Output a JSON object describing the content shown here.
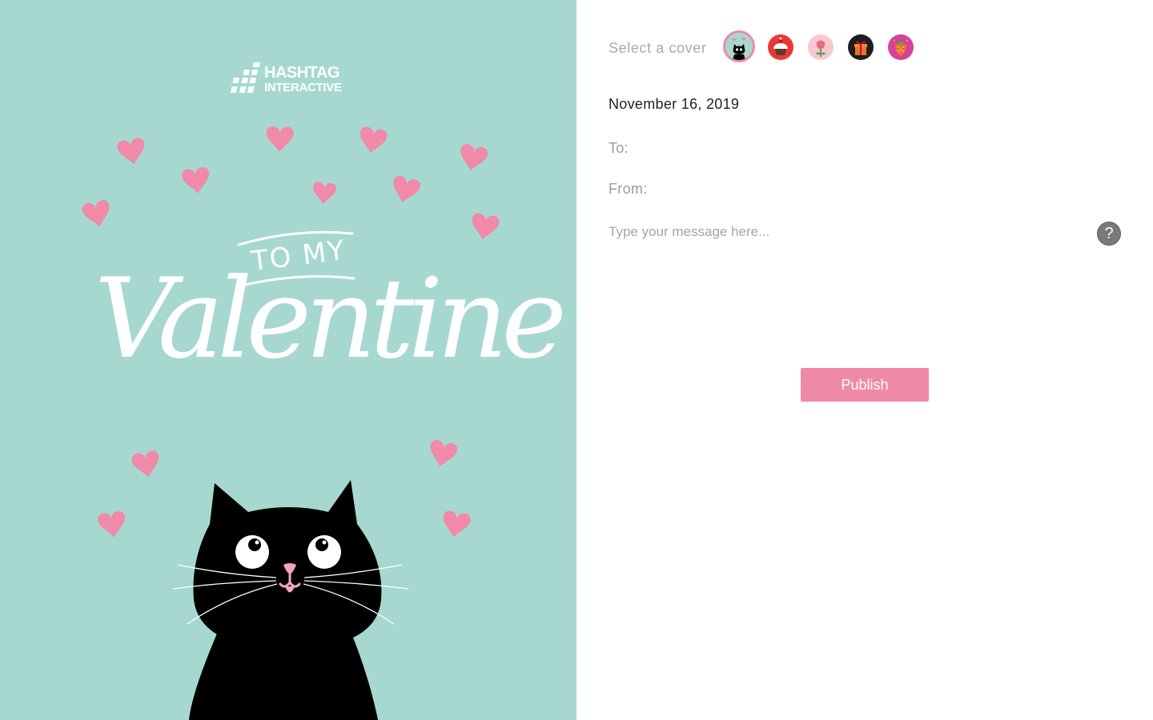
{
  "card": {
    "brand_line1": "HASHTAG",
    "brand_line2": "INTERACTIVE",
    "greeting_small": "TO MY",
    "greeting_big": "Valentine",
    "background_color": "#a6d8d0",
    "heart_color": "#f08aa8"
  },
  "form": {
    "select_cover_label": "Select a cover",
    "covers": [
      {
        "name": "black cat on mint",
        "icon": "cat-icon",
        "selected": true
      },
      {
        "name": "cupcake on red",
        "icon": "cupcake-icon",
        "selected": false
      },
      {
        "name": "rose on pink",
        "icon": "rose-icon",
        "selected": false
      },
      {
        "name": "gift on black",
        "icon": "gift-icon",
        "selected": false
      },
      {
        "name": "strawberry on magenta",
        "icon": "strawberry-icon",
        "selected": false
      }
    ],
    "date": "November 16, 2019",
    "to_label": "To:",
    "from_label": "From:",
    "message_placeholder": "Type your message here...",
    "help_icon": "?",
    "publish_label": "Publish",
    "accent_color": "#ef8aa6"
  }
}
